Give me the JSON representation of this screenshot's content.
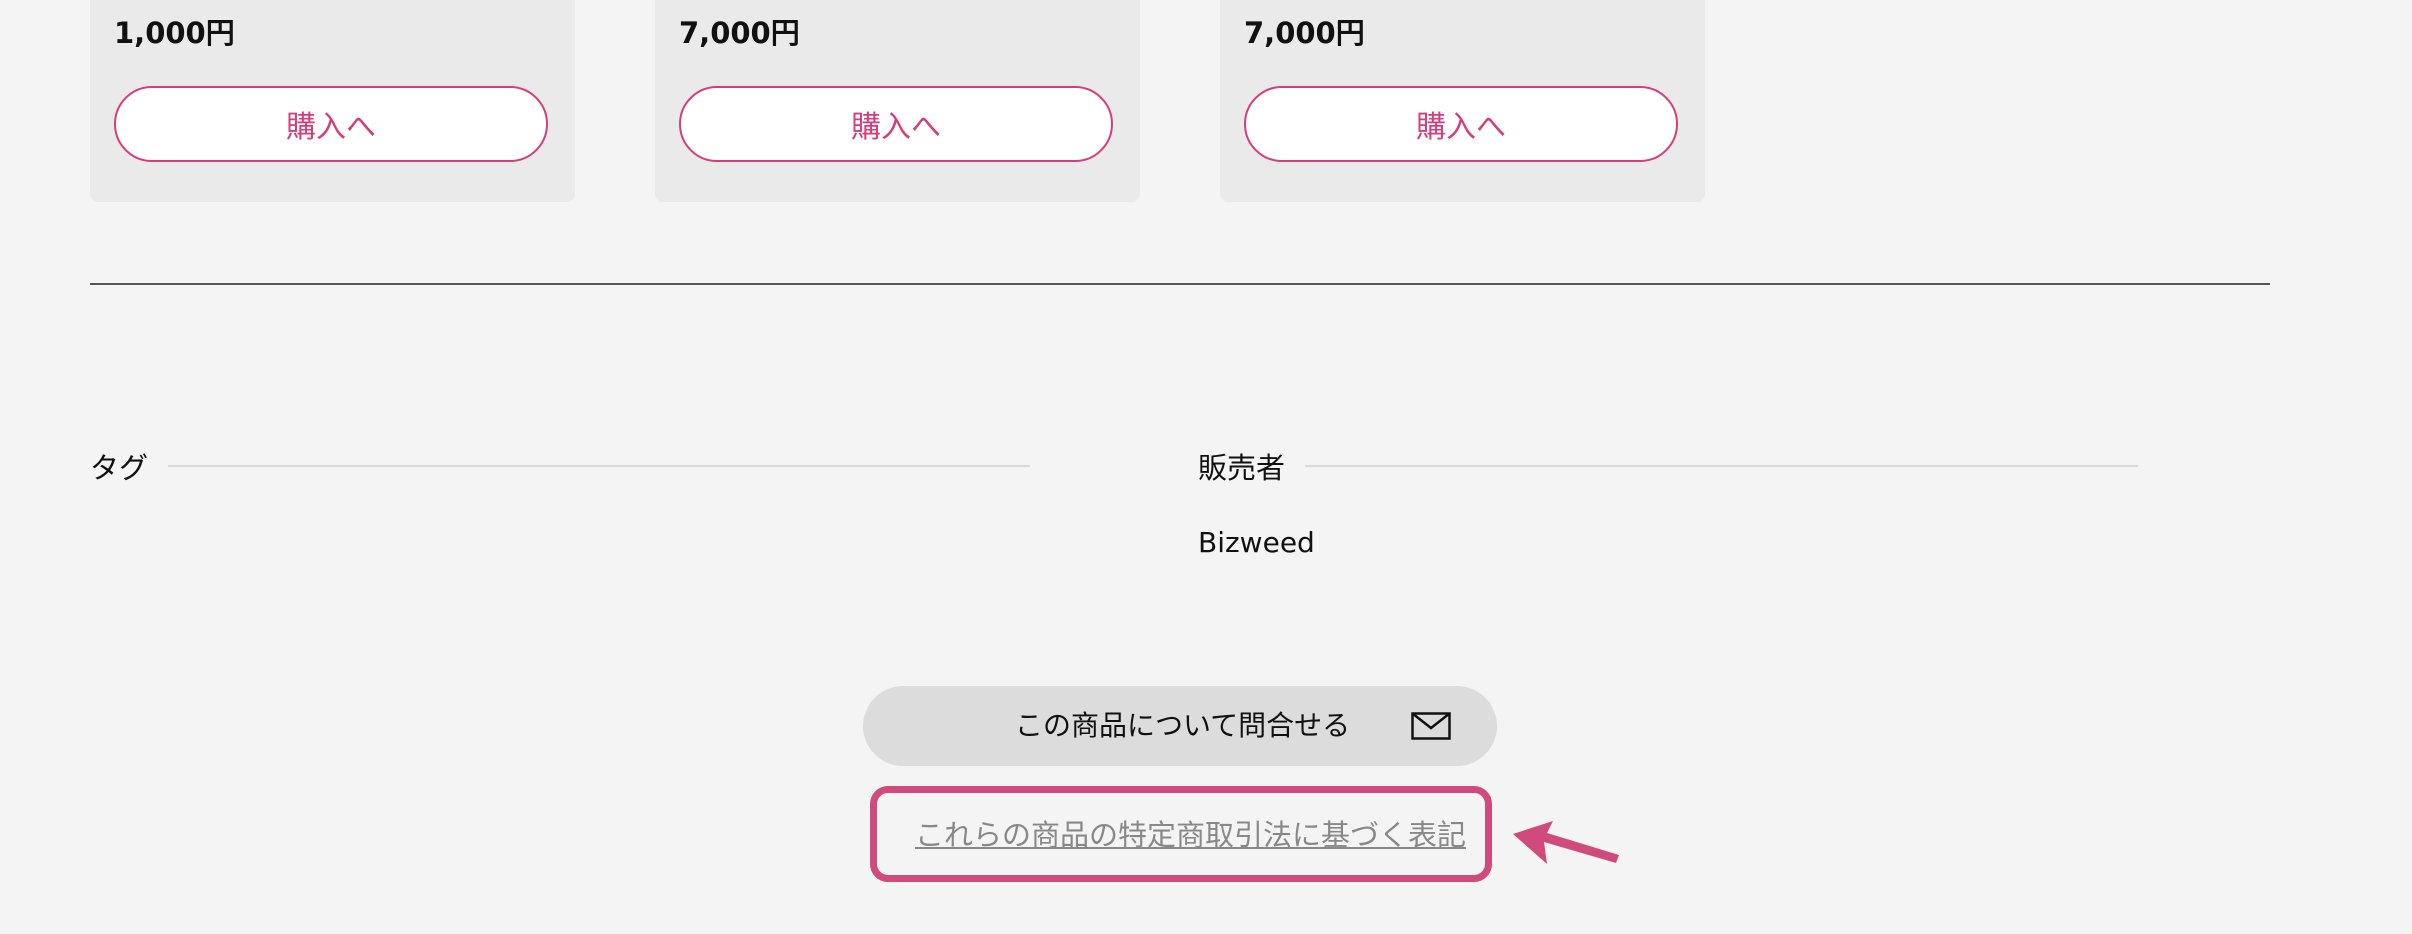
{
  "products": [
    {
      "price": "1,000円",
      "buy_label": "購入へ"
    },
    {
      "price": "7,000円",
      "buy_label": "購入へ"
    },
    {
      "price": "7,000円",
      "buy_label": "購入へ"
    }
  ],
  "tags_section": {
    "heading": "タグ"
  },
  "seller_section": {
    "heading": "販売者",
    "name": "Bizweed"
  },
  "contact": {
    "label": "この商品について問合せる",
    "icon": "mail-icon"
  },
  "legal_link": {
    "label": "これらの商品の特定商取引法に基づく表記"
  },
  "colors": {
    "accent": "#d63d7c",
    "highlight": "#d04a7b",
    "background": "#f4f4f4",
    "card": "#eaeaea",
    "contact_button": "#dcdcdc"
  }
}
